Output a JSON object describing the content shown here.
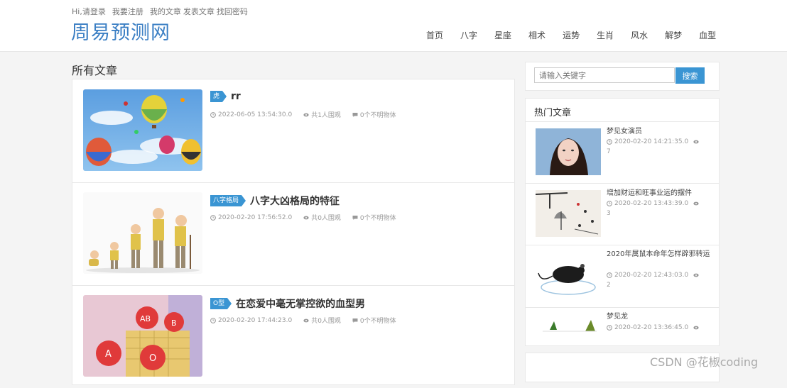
{
  "header": {
    "links": [
      "Hi,请登录",
      "我要注册",
      "我的文章",
      "发表文章",
      "找回密码"
    ],
    "logo": "周易预测网",
    "nav": [
      "首页",
      "八字",
      "星座",
      "相术",
      "运势",
      "生肖",
      "风水",
      "解梦",
      "血型"
    ]
  },
  "main": {
    "section_title": "所有文章",
    "articles": [
      {
        "tag": "虎",
        "title": "rr",
        "date": "2022-06-05 13:54:30.0",
        "views": "共1人围观",
        "comments": "0个不明物体"
      },
      {
        "tag": "八字格局",
        "title": "八字大凶格局的特征",
        "date": "2020-02-20 17:56:52.0",
        "views": "共0人围观",
        "comments": "0个不明物体"
      },
      {
        "tag": "O型",
        "title": "在恋爱中毫无掌控欲的血型男",
        "date": "2020-02-20 17:44:23.0",
        "views": "共0人围观",
        "comments": "0个不明物体"
      }
    ]
  },
  "sidebar": {
    "search": {
      "placeholder": "请输入关键字",
      "button": "搜索"
    },
    "hot_title": "热门文章",
    "hot": [
      {
        "title": "梦见女演员",
        "date": "2020-02-20 14:21:35.0",
        "views": "7"
      },
      {
        "title": "增加财运和旺事业运的摆件",
        "date": "2020-02-20 13:43:39.0",
        "views": "3"
      },
      {
        "title": "2020年属鼠本命年怎样辟邪转运",
        "date": "2020-02-20 12:43:03.0",
        "views": "2"
      },
      {
        "title": "梦见龙",
        "date": "2020-02-20 13:36:45.0",
        "views": ""
      }
    ]
  },
  "watermark": "CSDN @花椒coding",
  "colors": {
    "brand": "#3b7fc4",
    "accent": "#3a95d3"
  }
}
